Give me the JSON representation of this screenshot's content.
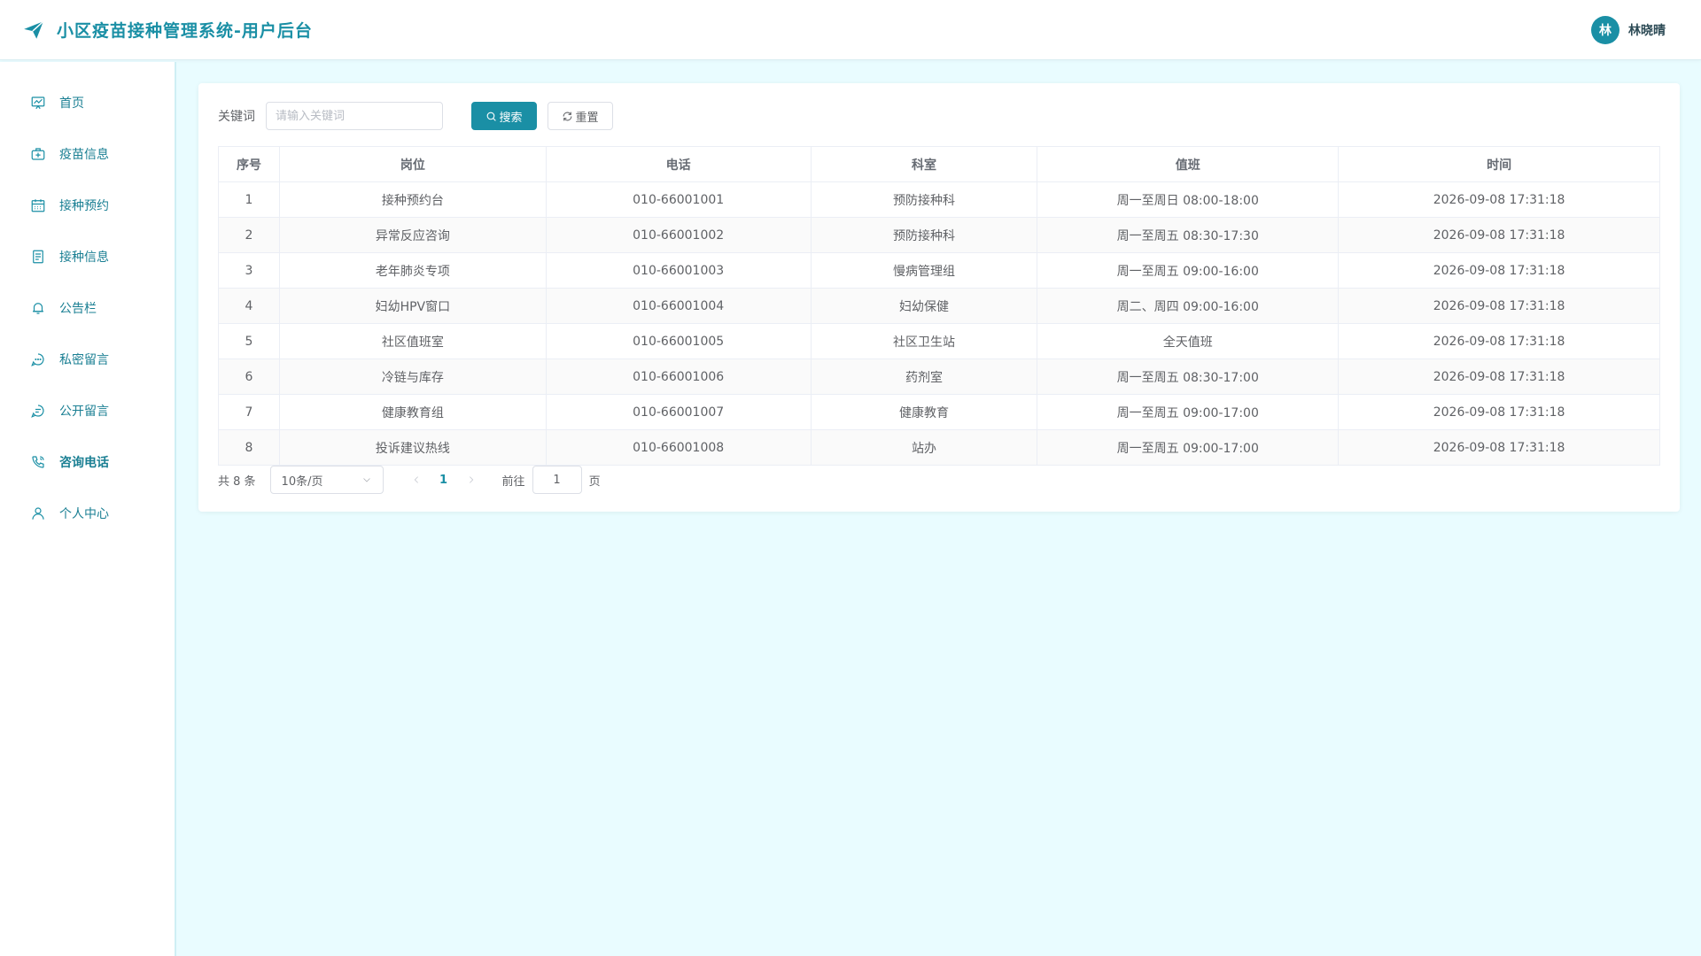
{
  "app": {
    "title": "小区疫苗接种管理系统-用户后台",
    "accent_color": "#1a8fa5",
    "logo_icon": "paper-plane-icon"
  },
  "user": {
    "avatar_letter": "林",
    "name": "林晓晴"
  },
  "sidebar": {
    "items": [
      {
        "label": "首页",
        "icon": "dashboard-icon",
        "active": false
      },
      {
        "label": "疫苗信息",
        "icon": "medkit-icon",
        "active": false
      },
      {
        "label": "接种预约",
        "icon": "calendar-icon",
        "active": false
      },
      {
        "label": "接种信息",
        "icon": "document-icon",
        "active": false
      },
      {
        "label": "公告栏",
        "icon": "bell-icon",
        "active": false
      },
      {
        "label": "私密留言",
        "icon": "chat-icon",
        "active": false
      },
      {
        "label": "公开留言",
        "icon": "message-icon",
        "active": false
      },
      {
        "label": "咨询电话",
        "icon": "phone-icon",
        "active": true
      },
      {
        "label": "个人中心",
        "icon": "user-icon",
        "active": false
      }
    ]
  },
  "search": {
    "label": "关键词",
    "placeholder": "请输入关键词",
    "value": "",
    "search_label": "搜索",
    "reset_label": "重置"
  },
  "table": {
    "columns": [
      "序号",
      "岗位",
      "电话",
      "科室",
      "值班",
      "时间"
    ],
    "rows": [
      [
        "1",
        "接种预约台",
        "010-66001001",
        "预防接种科",
        "周一至周日 08:00-18:00",
        "2026-09-08 17:31:18"
      ],
      [
        "2",
        "异常反应咨询",
        "010-66001002",
        "预防接种科",
        "周一至周五 08:30-17:30",
        "2026-09-08 17:31:18"
      ],
      [
        "3",
        "老年肺炎专项",
        "010-66001003",
        "慢病管理组",
        "周一至周五 09:00-16:00",
        "2026-09-08 17:31:18"
      ],
      [
        "4",
        "妇幼HPV窗口",
        "010-66001004",
        "妇幼保健",
        "周二、周四 09:00-16:00",
        "2026-09-08 17:31:18"
      ],
      [
        "5",
        "社区值班室",
        "010-66001005",
        "社区卫生站",
        "全天值班",
        "2026-09-08 17:31:18"
      ],
      [
        "6",
        "冷链与库存",
        "010-66001006",
        "药剂室",
        "周一至周五 08:30-17:00",
        "2026-09-08 17:31:18"
      ],
      [
        "7",
        "健康教育组",
        "010-66001007",
        "健康教育",
        "周一至周五 09:00-17:00",
        "2026-09-08 17:31:18"
      ],
      [
        "8",
        "投诉建议热线",
        "010-66001008",
        "站办",
        "周一至周五 09:00-17:00",
        "2026-09-08 17:31:18"
      ]
    ]
  },
  "pagination": {
    "total_text": "共 8 条",
    "page_size": "10条/页",
    "current_page": "1",
    "goto_label": "前往",
    "goto_value": "1",
    "page_unit": "页"
  }
}
